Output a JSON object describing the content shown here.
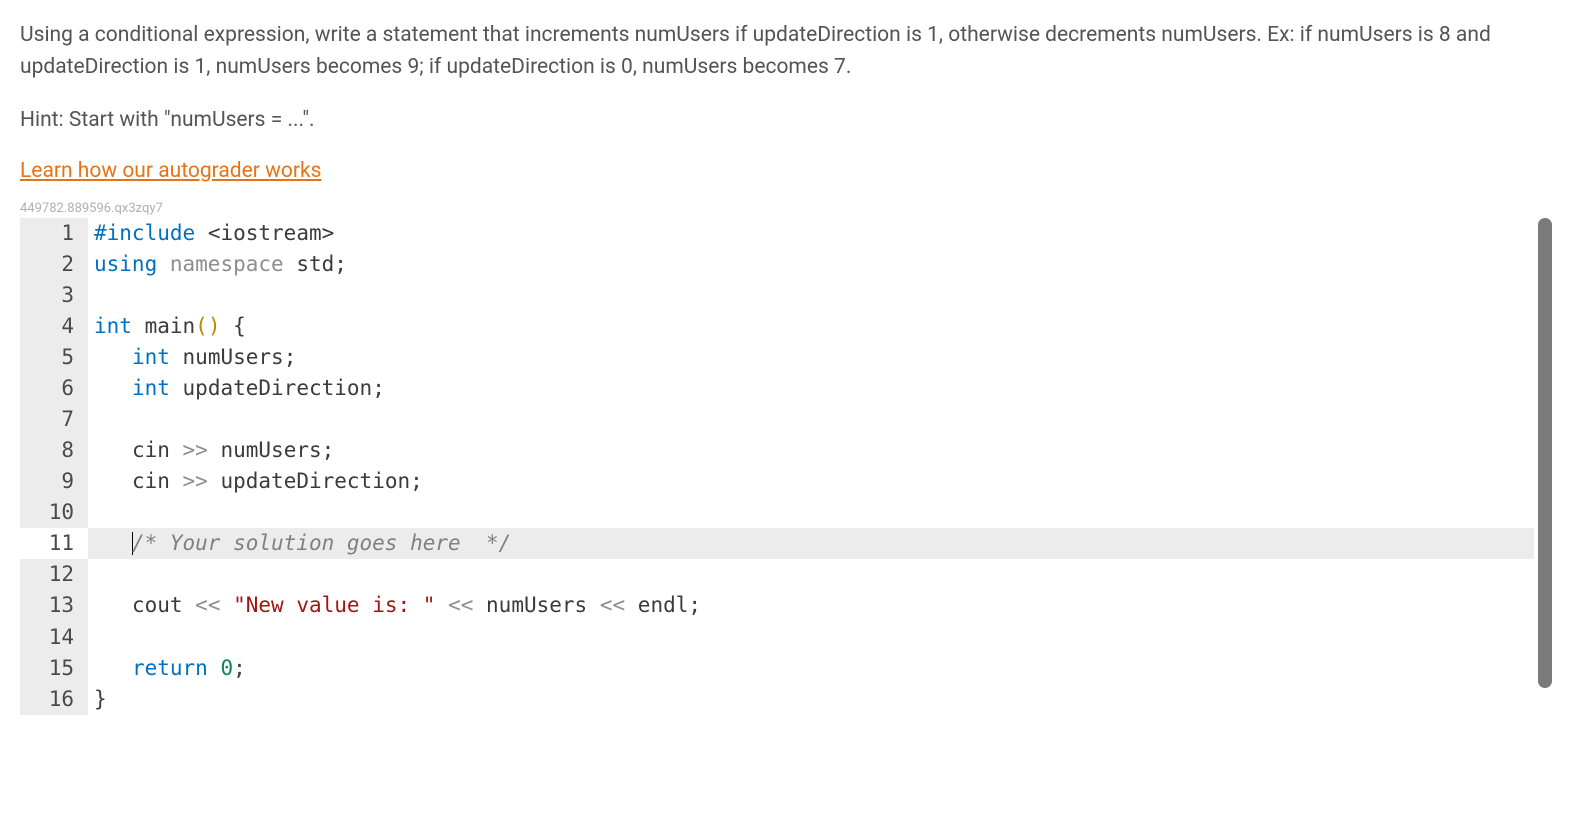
{
  "problem": {
    "description": "Using a conditional expression, write a statement that increments numUsers if updateDirection is 1, otherwise decrements numUsers. Ex: if numUsers is 8 and updateDirection is 1, numUsers becomes 9; if updateDirection is 0, numUsers becomes 7.",
    "hint": "Hint: Start with \"numUsers = ...\"."
  },
  "links": {
    "autograder": "Learn how our autograder works"
  },
  "session_id": "449782.889596.qx3zqy7",
  "code": {
    "active_line": 11,
    "lines": [
      {
        "n": 1,
        "tokens": [
          [
            "tok-preproc",
            "#include"
          ],
          [
            "",
            " "
          ],
          [
            "tok-angle",
            "<"
          ],
          [
            "tok-include-t",
            "iostream"
          ],
          [
            "tok-angle",
            ">"
          ]
        ]
      },
      {
        "n": 2,
        "tokens": [
          [
            "tok-keyword",
            "using"
          ],
          [
            "",
            " "
          ],
          [
            "tok-namespace",
            "namespace"
          ],
          [
            "",
            " "
          ],
          [
            "tok-ident",
            "std"
          ],
          [
            "tok-punct",
            ";"
          ]
        ]
      },
      {
        "n": 3,
        "tokens": []
      },
      {
        "n": 4,
        "tokens": [
          [
            "tok-keyword",
            "int"
          ],
          [
            "",
            " "
          ],
          [
            "tok-ident",
            "main"
          ],
          [
            "tok-paren",
            "()"
          ],
          [
            "",
            " "
          ],
          [
            "tok-punct",
            "{"
          ]
        ]
      },
      {
        "n": 5,
        "tokens": [
          [
            "",
            "   "
          ],
          [
            "tok-keyword",
            "int"
          ],
          [
            "",
            " "
          ],
          [
            "tok-ident",
            "numUsers"
          ],
          [
            "tok-punct",
            ";"
          ]
        ]
      },
      {
        "n": 6,
        "tokens": [
          [
            "",
            "   "
          ],
          [
            "tok-keyword",
            "int"
          ],
          [
            "",
            " "
          ],
          [
            "tok-ident",
            "updateDirection"
          ],
          [
            "tok-punct",
            ";"
          ]
        ]
      },
      {
        "n": 7,
        "tokens": []
      },
      {
        "n": 8,
        "tokens": [
          [
            "",
            "   "
          ],
          [
            "tok-ident",
            "cin"
          ],
          [
            "",
            " "
          ],
          [
            "tok-op",
            ">>"
          ],
          [
            "",
            " "
          ],
          [
            "tok-ident",
            "numUsers"
          ],
          [
            "tok-punct",
            ";"
          ]
        ]
      },
      {
        "n": 9,
        "tokens": [
          [
            "",
            "   "
          ],
          [
            "tok-ident",
            "cin"
          ],
          [
            "",
            " "
          ],
          [
            "tok-op",
            ">>"
          ],
          [
            "",
            " "
          ],
          [
            "tok-ident",
            "updateDirection"
          ],
          [
            "tok-punct",
            ";"
          ]
        ]
      },
      {
        "n": 10,
        "tokens": []
      },
      {
        "n": 11,
        "highlight": true,
        "cursor": true,
        "tokens": [
          [
            "",
            "   "
          ],
          [
            "tok-comment",
            "/* Your solution goes here  */"
          ]
        ]
      },
      {
        "n": 12,
        "tokens": []
      },
      {
        "n": 13,
        "tokens": [
          [
            "",
            "   "
          ],
          [
            "tok-ident",
            "cout"
          ],
          [
            "",
            " "
          ],
          [
            "tok-op",
            "<<"
          ],
          [
            "",
            " "
          ],
          [
            "tok-string",
            "\"New value is: \""
          ],
          [
            "",
            " "
          ],
          [
            "tok-op",
            "<<"
          ],
          [
            "",
            " "
          ],
          [
            "tok-ident",
            "numUsers"
          ],
          [
            "",
            " "
          ],
          [
            "tok-op",
            "<<"
          ],
          [
            "",
            " "
          ],
          [
            "tok-ident",
            "endl"
          ],
          [
            "tok-punct",
            ";"
          ]
        ]
      },
      {
        "n": 14,
        "tokens": []
      },
      {
        "n": 15,
        "tokens": [
          [
            "",
            "   "
          ],
          [
            "tok-keyword",
            "return"
          ],
          [
            "",
            " "
          ],
          [
            "tok-number",
            "0"
          ],
          [
            "tok-punct",
            ";"
          ]
        ]
      },
      {
        "n": 16,
        "tokens": [
          [
            "tok-punct",
            "}"
          ]
        ]
      }
    ]
  }
}
